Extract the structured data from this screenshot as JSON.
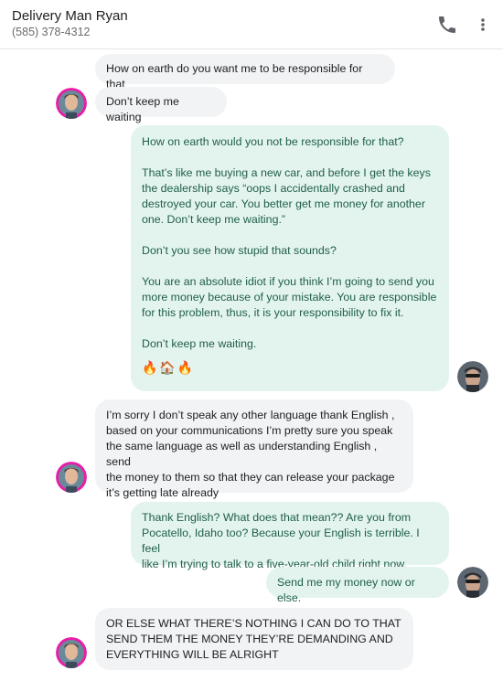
{
  "header": {
    "contact_name": "Delivery Man Ryan",
    "contact_phone": "(585) 378-4312",
    "call_icon": "phone-icon",
    "more_icon": "more-vert-icon"
  },
  "messages": [
    {
      "from": "contact",
      "lines": [
        "How on earth do you want me to be responsible for that"
      ]
    },
    {
      "from": "contact",
      "lines": [
        "Don’t keep me waiting"
      ]
    },
    {
      "from": "me",
      "lines": [
        "How on earth would you not be responsible for that?",
        "",
        "That’s like me buying a new car, and before I get the keys",
        "the dealership says “oops I accidentally crashed and",
        "destroyed your car. You better get me money for another",
        "one. Don’t keep me waiting.”",
        "",
        "Don’t you see how stupid that sounds?",
        "",
        "You are an absolute idiot if you think I’m going to send you",
        "more money because of your mistake. You are responsible",
        "for this problem, thus, it is your responsibility to fix it.",
        "",
        "Don’t keep me waiting."
      ],
      "emoji": "🔥🏠🔥"
    },
    {
      "from": "contact",
      "lines": [
        "I’m sorry I don’t speak any other language thank English ,",
        "based on your communications I’m pretty sure you speak",
        "the same language as well as understanding English , send",
        "the money to them so that they can release your package",
        "it’s getting late already"
      ]
    },
    {
      "from": "me",
      "lines": [
        "Thank English? What does that mean?? Are you from",
        "Pocatello, Idaho too? Because your English is terrible. I feel",
        "like I’m trying to talk to a five-year-old child right now."
      ]
    },
    {
      "from": "me",
      "lines": [
        "Send me my money now or else."
      ]
    },
    {
      "from": "contact",
      "lines": [
        "OR ELSE WHAT THERE’S NOTHING I CAN DO TO THAT",
        "SEND THEM THE MONEY THEY’RE DEMANDING AND",
        "EVERYTHING WILL BE ALRIGHT"
      ]
    }
  ],
  "colors": {
    "incoming_bubble": "#f1f3f4",
    "outgoing_bubble": "#e3f4ef",
    "outgoing_text": "#1f5f46",
    "contact_avatar_ring": "#e91ea8"
  }
}
